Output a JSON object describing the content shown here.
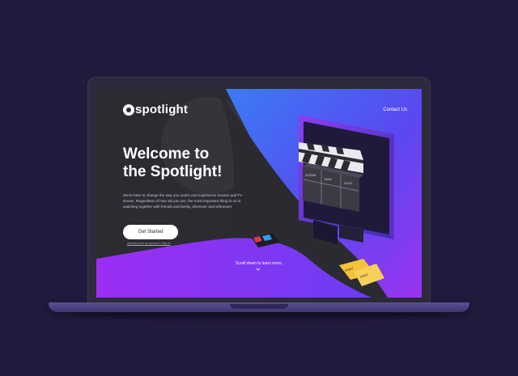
{
  "site": {
    "logo_text": "spotlight",
    "nav_contact": "Contact Us"
  },
  "hero": {
    "title_line1": "Welcome to",
    "title_line2": "the Spotlight!",
    "description": "We're here to change the way you watch and experience movies and TV shows. Regardless of how old you are, the most important thing to us is watching together with friends and family, wherever and whenever.",
    "cta_label": "Get Started",
    "login_link": "Already have an account? Sign in",
    "scroll_hint": "Scroll down to learn more."
  },
  "clapperboard": {
    "labels": [
      "SCENE",
      "TAKE",
      "DATE"
    ]
  },
  "tickets": {
    "labels": [
      "ADMIT",
      "ADMIT"
    ]
  },
  "colors": {
    "page_bg": "#221a3d",
    "screen_bg": "#2b2b30",
    "accent_blue": "#2f6df0",
    "accent_purple": "#8d2ff0",
    "ticket_yellow": "#f3c238"
  },
  "icons": {
    "scroll": "chevron-down-icon",
    "hero_art": "clapperboard-icon"
  }
}
